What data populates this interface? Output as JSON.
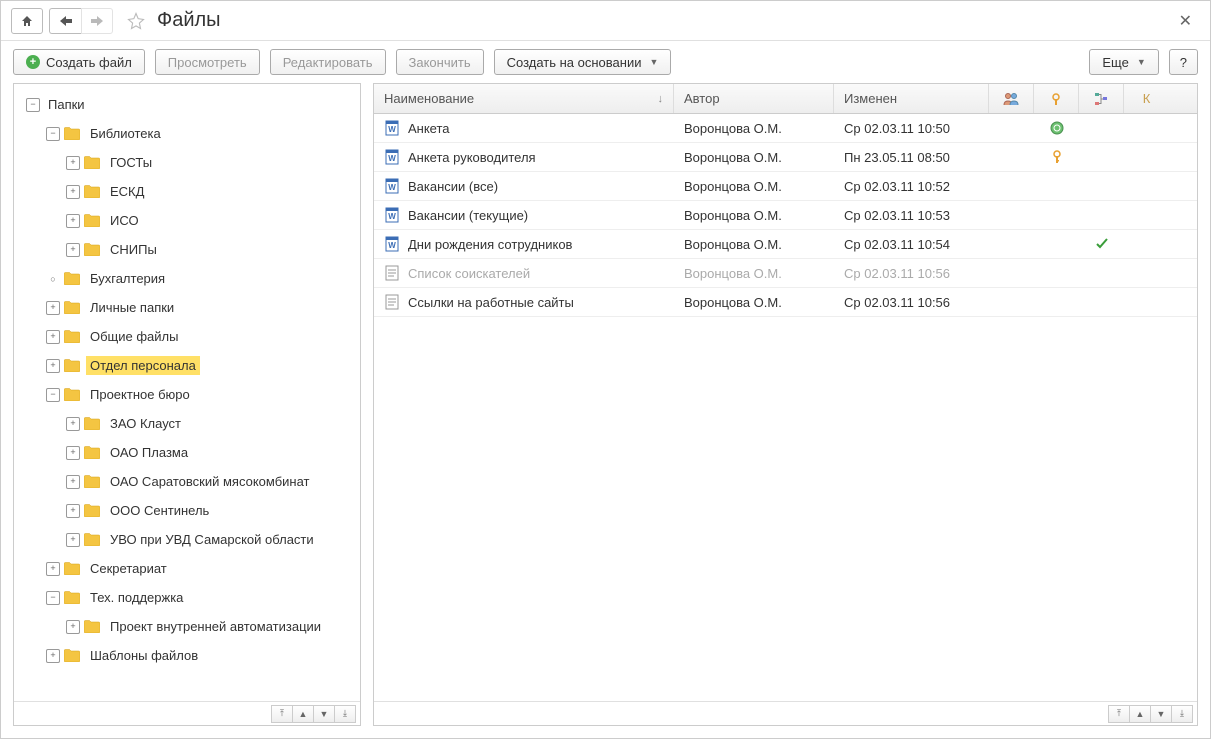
{
  "title": "Файлы",
  "toolbar": {
    "create": "Создать файл",
    "view": "Просмотреть",
    "edit": "Редактировать",
    "finish": "Закончить",
    "create_based": "Создать на основании",
    "more": "Еще",
    "help": "?"
  },
  "tree": {
    "root": "Папки",
    "items": [
      {
        "label": "Библиотека",
        "level": 1,
        "exp": "minus",
        "children": [
          {
            "label": "ГОСТы",
            "level": 2,
            "exp": "plus"
          },
          {
            "label": "ЕСКД",
            "level": 2,
            "exp": "plus"
          },
          {
            "label": "ИСО",
            "level": 2,
            "exp": "plus"
          },
          {
            "label": "СНИПы",
            "level": 2,
            "exp": "plus"
          }
        ]
      },
      {
        "label": "Бухгалтерия",
        "level": 1,
        "exp": "circle"
      },
      {
        "label": "Личные папки",
        "level": 1,
        "exp": "plus"
      },
      {
        "label": "Общие файлы",
        "level": 1,
        "exp": "plus"
      },
      {
        "label": "Отдел персонала",
        "level": 1,
        "exp": "plus",
        "selected": true
      },
      {
        "label": "Проектное бюро",
        "level": 1,
        "exp": "minus",
        "children": [
          {
            "label": "ЗАО Клауст",
            "level": 2,
            "exp": "plus"
          },
          {
            "label": "ОАО Плазма",
            "level": 2,
            "exp": "plus"
          },
          {
            "label": "ОАО Саратовский мясокомбинат",
            "level": 2,
            "exp": "plus"
          },
          {
            "label": "ООО Сентинель",
            "level": 2,
            "exp": "plus"
          },
          {
            "label": "УВО при УВД Самарской области",
            "level": 2,
            "exp": "plus"
          }
        ]
      },
      {
        "label": "Секретариат",
        "level": 1,
        "exp": "plus"
      },
      {
        "label": "Тех. поддержка",
        "level": 1,
        "exp": "minus",
        "children": [
          {
            "label": "Проект внутренней автоматизации",
            "level": 2,
            "exp": "plus"
          }
        ]
      },
      {
        "label": "Шаблоны файлов",
        "level": 1,
        "exp": "plus"
      }
    ]
  },
  "grid": {
    "columns": {
      "name": "Наименование",
      "author": "Автор",
      "modified": "Изменен",
      "k": "К"
    },
    "rows": [
      {
        "icon": "word",
        "name": "Анкета",
        "author": "Воронцова О.М.",
        "modified": "Ср 02.03.11 10:50",
        "status": "green"
      },
      {
        "icon": "word",
        "name": "Анкета руководителя",
        "author": "Воронцова О.М.",
        "modified": "Пн 23.05.11 08:50",
        "status": "key"
      },
      {
        "icon": "word",
        "name": "Вакансии (все)",
        "author": "Воронцова О.М.",
        "modified": "Ср 02.03.11 10:52"
      },
      {
        "icon": "word",
        "name": "Вакансии (текущие)",
        "author": "Воронцова О.М.",
        "modified": "Ср 02.03.11 10:53"
      },
      {
        "icon": "word",
        "name": "Дни рождения сотрудников",
        "author": "Воронцова О.М.",
        "modified": "Ср 02.03.11 10:54",
        "check": true
      },
      {
        "icon": "text",
        "name": "Список соискателей",
        "author": "Воронцова О.М.",
        "modified": "Ср 02.03.11 10:56",
        "disabled": true
      },
      {
        "icon": "text",
        "name": "Ссылки на работные сайты",
        "author": "Воронцова О.М.",
        "modified": "Ср 02.03.11 10:56"
      }
    ]
  }
}
